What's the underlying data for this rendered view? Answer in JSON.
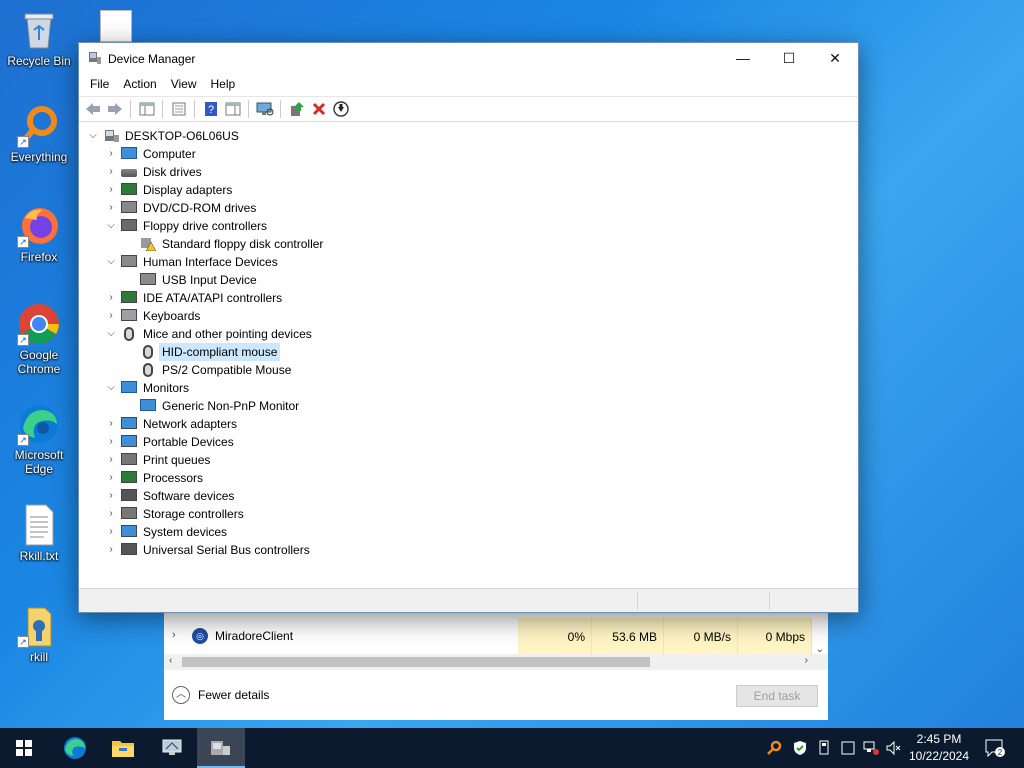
{
  "desktop": {
    "icons": [
      {
        "label": "Recycle Bin",
        "icon": "recycle-bin-icon"
      },
      {
        "label": "Everything",
        "icon": "everything-search-icon"
      },
      {
        "label": "Firefox",
        "icon": "firefox-icon"
      },
      {
        "label": "Google Chrome",
        "icon": "chrome-icon"
      },
      {
        "label": "Microsoft Edge",
        "icon": "edge-icon"
      },
      {
        "label": "Rkill.txt",
        "icon": "text-file-icon"
      },
      {
        "label": "rkill",
        "icon": "rkill-icon"
      }
    ]
  },
  "window": {
    "title": "Device Manager",
    "menu": [
      "File",
      "Action",
      "View",
      "Help"
    ],
    "toolbar_icons": [
      "back-arrow-icon",
      "forward-arrow-icon",
      "show-hide-tree-icon",
      "properties-icon",
      "help-icon",
      "action-pane-icon",
      "scan-hardware-icon",
      "update-driver-icon",
      "uninstall-device-icon",
      "disable-device-icon"
    ]
  },
  "tree": {
    "root": "DESKTOP-O6L06US",
    "items": [
      {
        "label": "Computer",
        "level": 1,
        "expand": "collapsed",
        "icon": "computer-icon"
      },
      {
        "label": "Disk drives",
        "level": 1,
        "expand": "collapsed",
        "icon": "disk-drive-icon"
      },
      {
        "label": "Display adapters",
        "level": 1,
        "expand": "collapsed",
        "icon": "display-adapter-icon"
      },
      {
        "label": "DVD/CD-ROM drives",
        "level": 1,
        "expand": "collapsed",
        "icon": "dvd-drive-icon"
      },
      {
        "label": "Floppy drive controllers",
        "level": 1,
        "expand": "expanded",
        "icon": "floppy-controller-icon"
      },
      {
        "label": "Standard floppy disk controller",
        "level": 2,
        "expand": "none",
        "icon": "warning-device-icon"
      },
      {
        "label": "Human Interface Devices",
        "level": 1,
        "expand": "expanded",
        "icon": "hid-icon"
      },
      {
        "label": "USB Input Device",
        "level": 2,
        "expand": "none",
        "icon": "hid-icon"
      },
      {
        "label": "IDE ATA/ATAPI controllers",
        "level": 1,
        "expand": "collapsed",
        "icon": "ide-controller-icon"
      },
      {
        "label": "Keyboards",
        "level": 1,
        "expand": "collapsed",
        "icon": "keyboard-icon"
      },
      {
        "label": "Mice and other pointing devices",
        "level": 1,
        "expand": "expanded",
        "icon": "mouse-icon"
      },
      {
        "label": "HID-compliant mouse",
        "level": 2,
        "expand": "none",
        "icon": "mouse-icon",
        "selected": true
      },
      {
        "label": "PS/2 Compatible Mouse",
        "level": 2,
        "expand": "none",
        "icon": "mouse-icon"
      },
      {
        "label": "Monitors",
        "level": 1,
        "expand": "expanded",
        "icon": "monitor-icon"
      },
      {
        "label": "Generic Non-PnP Monitor",
        "level": 2,
        "expand": "none",
        "icon": "monitor-icon"
      },
      {
        "label": "Network adapters",
        "level": 1,
        "expand": "collapsed",
        "icon": "network-adapter-icon"
      },
      {
        "label": "Portable Devices",
        "level": 1,
        "expand": "collapsed",
        "icon": "portable-device-icon"
      },
      {
        "label": "Print queues",
        "level": 1,
        "expand": "collapsed",
        "icon": "printer-icon"
      },
      {
        "label": "Processors",
        "level": 1,
        "expand": "collapsed",
        "icon": "processor-icon"
      },
      {
        "label": "Software devices",
        "level": 1,
        "expand": "collapsed",
        "icon": "software-device-icon"
      },
      {
        "label": "Storage controllers",
        "level": 1,
        "expand": "collapsed",
        "icon": "storage-controller-icon"
      },
      {
        "label": "System devices",
        "level": 1,
        "expand": "collapsed",
        "icon": "system-device-icon"
      },
      {
        "label": "Universal Serial Bus controllers",
        "level": 1,
        "expand": "collapsed",
        "icon": "usb-icon"
      }
    ]
  },
  "taskmanager": {
    "process": {
      "name": "MiradoreClient",
      "cpu": "0%",
      "memory": "53.6 MB",
      "disk": "0 MB/s",
      "network": "0 Mbps"
    },
    "fewer_details": "Fewer details",
    "end_task": "End task"
  },
  "taskbar": {
    "items": [
      "start-icon",
      "edge-icon",
      "file-explorer-icon",
      "remote-desktop-icon",
      "device-manager-icon"
    ],
    "tray": [
      "everything-search-icon",
      "security-icon",
      "usb-eject-icon",
      "tablet-icon",
      "network-icon",
      "volume-muted-icon"
    ],
    "time": "2:45 PM",
    "date": "10/22/2024",
    "notifications": "2"
  },
  "colors": {
    "selection": "#cce8ff",
    "taskbar": "#0b1a2e",
    "accent": "#1a86e3",
    "resource_highlight": "#fff4c4"
  }
}
